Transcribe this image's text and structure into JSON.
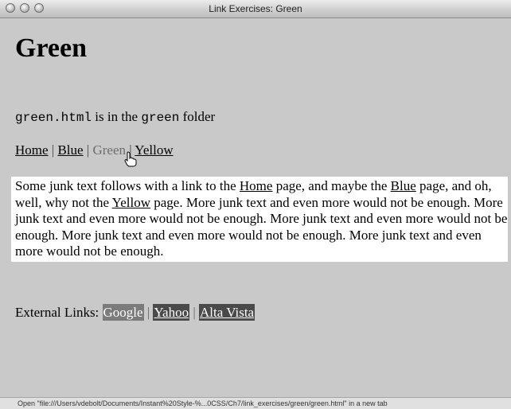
{
  "window": {
    "title": "Link Exercises: Green"
  },
  "page": {
    "heading": "Green",
    "file_name": "green.html",
    "file_mid": " is in the ",
    "folder_name": "green",
    "file_end": " folder"
  },
  "nav": {
    "home": "Home",
    "blue": "Blue",
    "green": "Green",
    "yellow": "Yellow",
    "sep": " | "
  },
  "junk": {
    "t1": "Some junk text follows with a link to the ",
    "link_home": "Home",
    "t2": " page, and maybe the ",
    "link_blue": "Blue",
    "t3": " page, and oh, well, why not the ",
    "link_yellow": "Yellow",
    "t4": " page. More junk text and even more would not be enough. More junk text and even more would not be enough. More junk text and even more would not be enough. More junk text and even more would not be enough. More junk text and even more would not be enough."
  },
  "external": {
    "label": "External Links: ",
    "google": "Google",
    "yahoo": "Yahoo",
    "altavista": "Alta Vista",
    "sep": " | "
  },
  "status": {
    "text": "Open \"file:///Users/vdebolt/Documents/Instant%20Style-%...0CSS/Ch7/link_exercises/green/green.html\" in a new tab"
  }
}
